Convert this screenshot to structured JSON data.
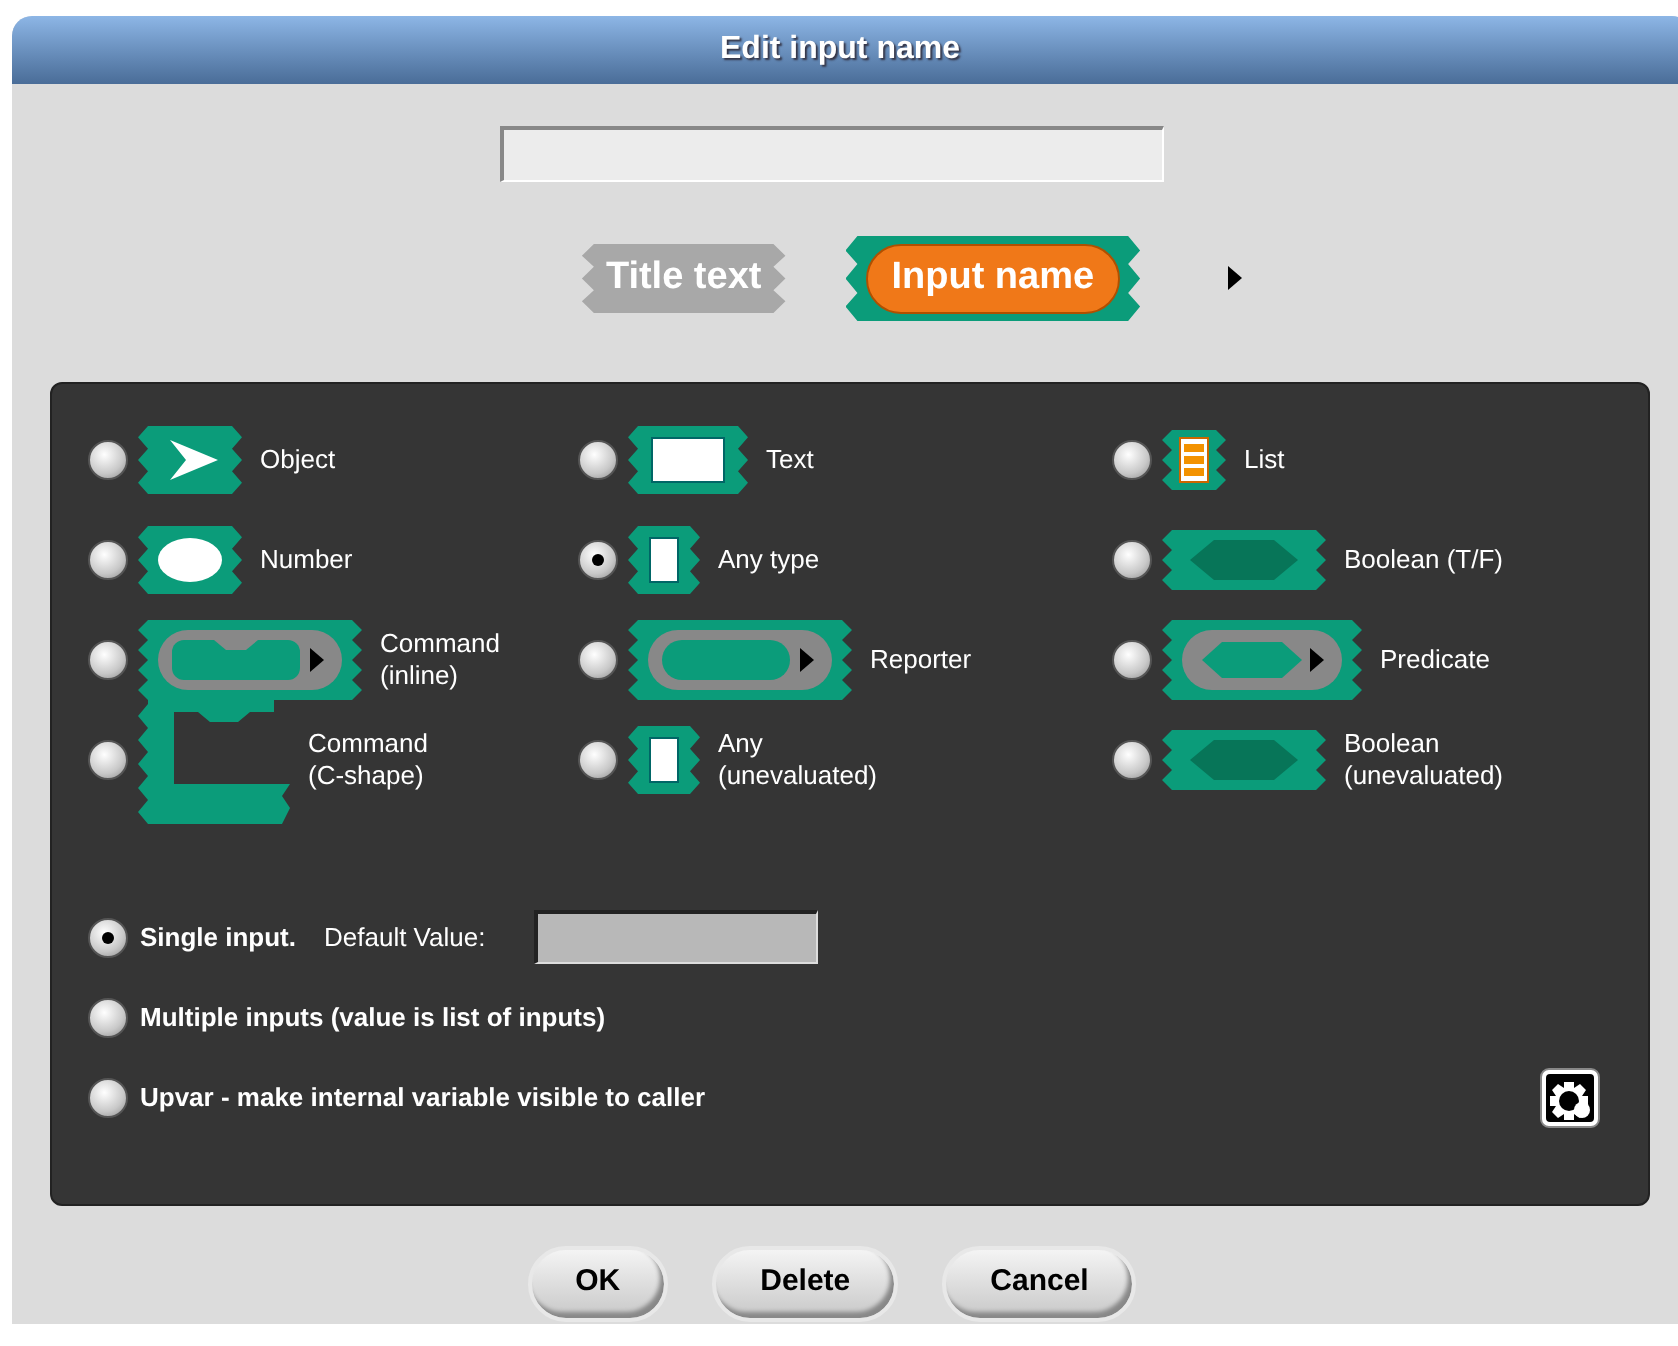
{
  "window": {
    "title": "Edit input name"
  },
  "block_options": [
    {
      "label": "Title text",
      "selected": false
    },
    {
      "label": "Input name",
      "selected": true
    }
  ],
  "types": [
    {
      "label": "Object",
      "kind": "object",
      "selected": false
    },
    {
      "label": "Text",
      "kind": "text",
      "selected": false
    },
    {
      "label": "List",
      "kind": "list",
      "selected": false
    },
    {
      "label": "Number",
      "kind": "number",
      "selected": false
    },
    {
      "label": "Any type",
      "kind": "any",
      "selected": true
    },
    {
      "label": "Boolean (T/F)",
      "kind": "boolean",
      "selected": false
    },
    {
      "label": "Command\n(inline)",
      "kind": "command",
      "selected": false
    },
    {
      "label": "Reporter",
      "kind": "reporter",
      "selected": false
    },
    {
      "label": "Predicate",
      "kind": "predicate",
      "selected": false
    },
    {
      "label": "Command\n(C-shape)",
      "kind": "cshape",
      "selected": false
    },
    {
      "label": "Any\n(unevaluated)",
      "kind": "any",
      "selected": false
    },
    {
      "label": "Boolean\n(unevaluated)",
      "kind": "boolean",
      "selected": false
    }
  ],
  "input_modes": [
    {
      "label": "Single input.",
      "selected": true,
      "default_label": "Default Value:"
    },
    {
      "label": "Multiple inputs (value is list of inputs)",
      "selected": false
    },
    {
      "label": "Upvar - make internal variable visible to caller",
      "selected": false
    }
  ],
  "buttons": [
    "OK",
    "Delete",
    "Cancel"
  ]
}
